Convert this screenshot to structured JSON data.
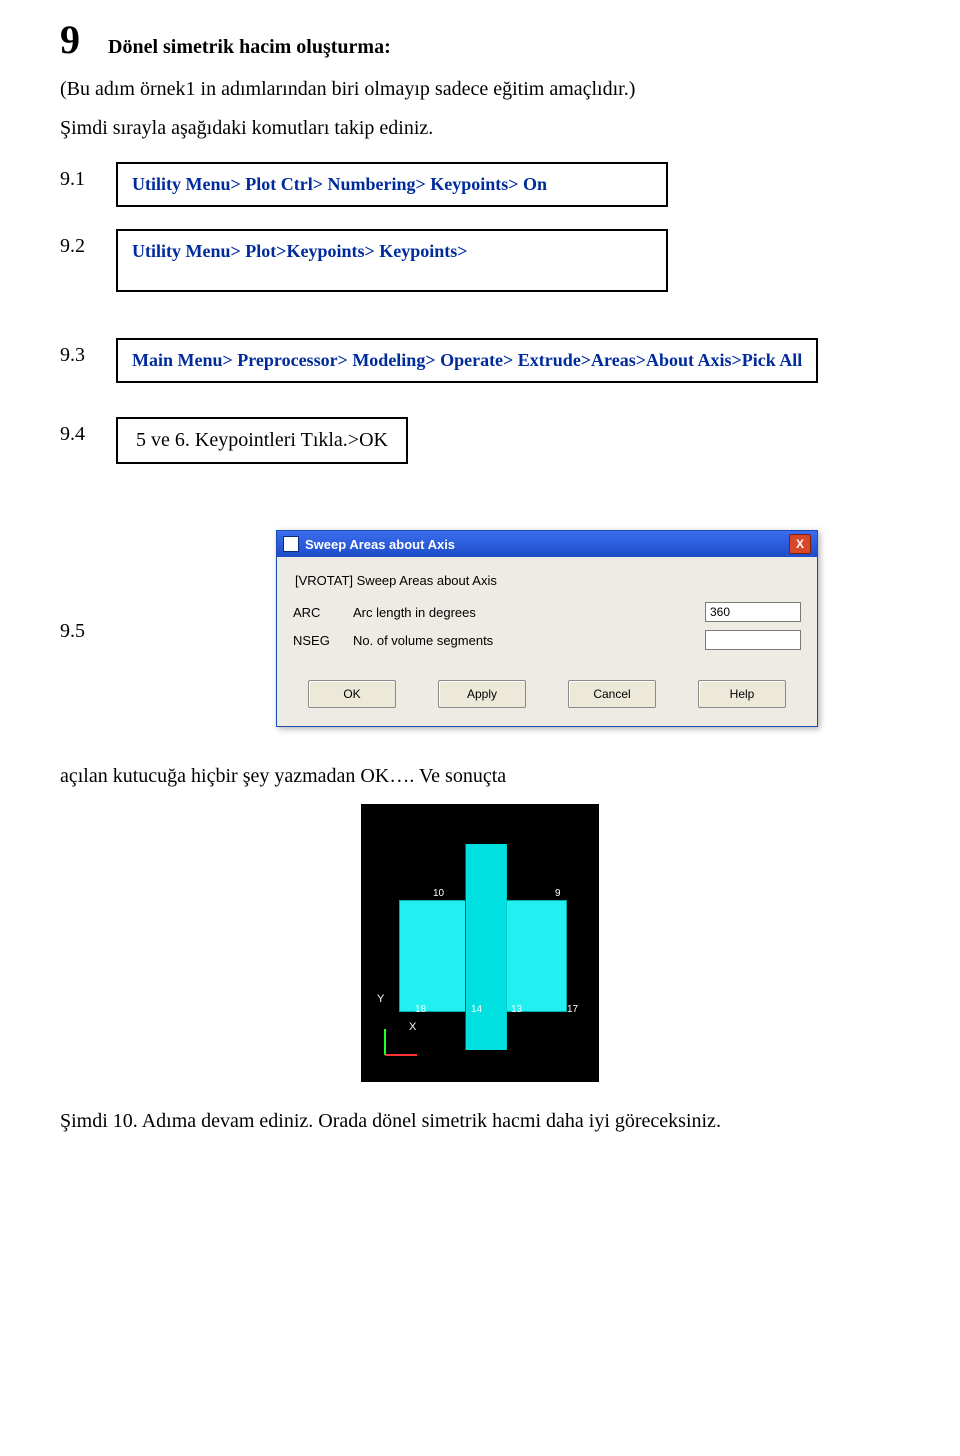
{
  "title": {
    "num": "9",
    "heading": "Dönel simetrik hacim oluşturma:"
  },
  "intro1": "(Bu adım örnek1 in adımlarından biri olmayıp sadece eğitim amaçlıdır.)",
  "intro2": "Şimdi sırayla aşağıdaki komutları takip ediniz.",
  "steps": {
    "s91": {
      "n": "9.1",
      "cmd": "Utility Menu> Plot Ctrl> Numbering> Keypoints> On"
    },
    "s92": {
      "n": "9.2",
      "cmd": "Utility Menu> Plot>Keypoints> Keypoints>"
    },
    "s93": {
      "n": "9.3",
      "cmd": "Main Menu> Preprocessor> Modeling> Operate> Extrude>Areas>About Axis>Pick All"
    },
    "s94": {
      "n": "9.4",
      "txt": "5 ve 6. Keypointleri Tıkla.>OK"
    },
    "s95": {
      "n": "9.5"
    }
  },
  "dialog": {
    "title": "Sweep Areas about Axis",
    "close": "X",
    "sub": "[VROTAT]  Sweep Areas about Axis",
    "row1": {
      "l1": "ARC",
      "l2": "Arc length in degrees",
      "val": "360"
    },
    "row2": {
      "l1": "NSEG",
      "l2": "No. of volume segments",
      "val": ""
    },
    "buttons": {
      "ok": "OK",
      "apply": "Apply",
      "cancel": "Cancel",
      "help": "Help"
    }
  },
  "after_dialog": "açılan kutucuğa hiçbir şey yazmadan OK….   Ve sonuçta",
  "render_labels": {
    "k10": "10",
    "k9": "9",
    "k18": "18",
    "k14": "14",
    "k13": "13",
    "k17": "17",
    "ax_y": "Y",
    "ax_x": "X"
  },
  "footer": "Şimdi 10. Adıma devam ediniz. Orada dönel simetrik hacmi daha iyi göreceksiniz."
}
